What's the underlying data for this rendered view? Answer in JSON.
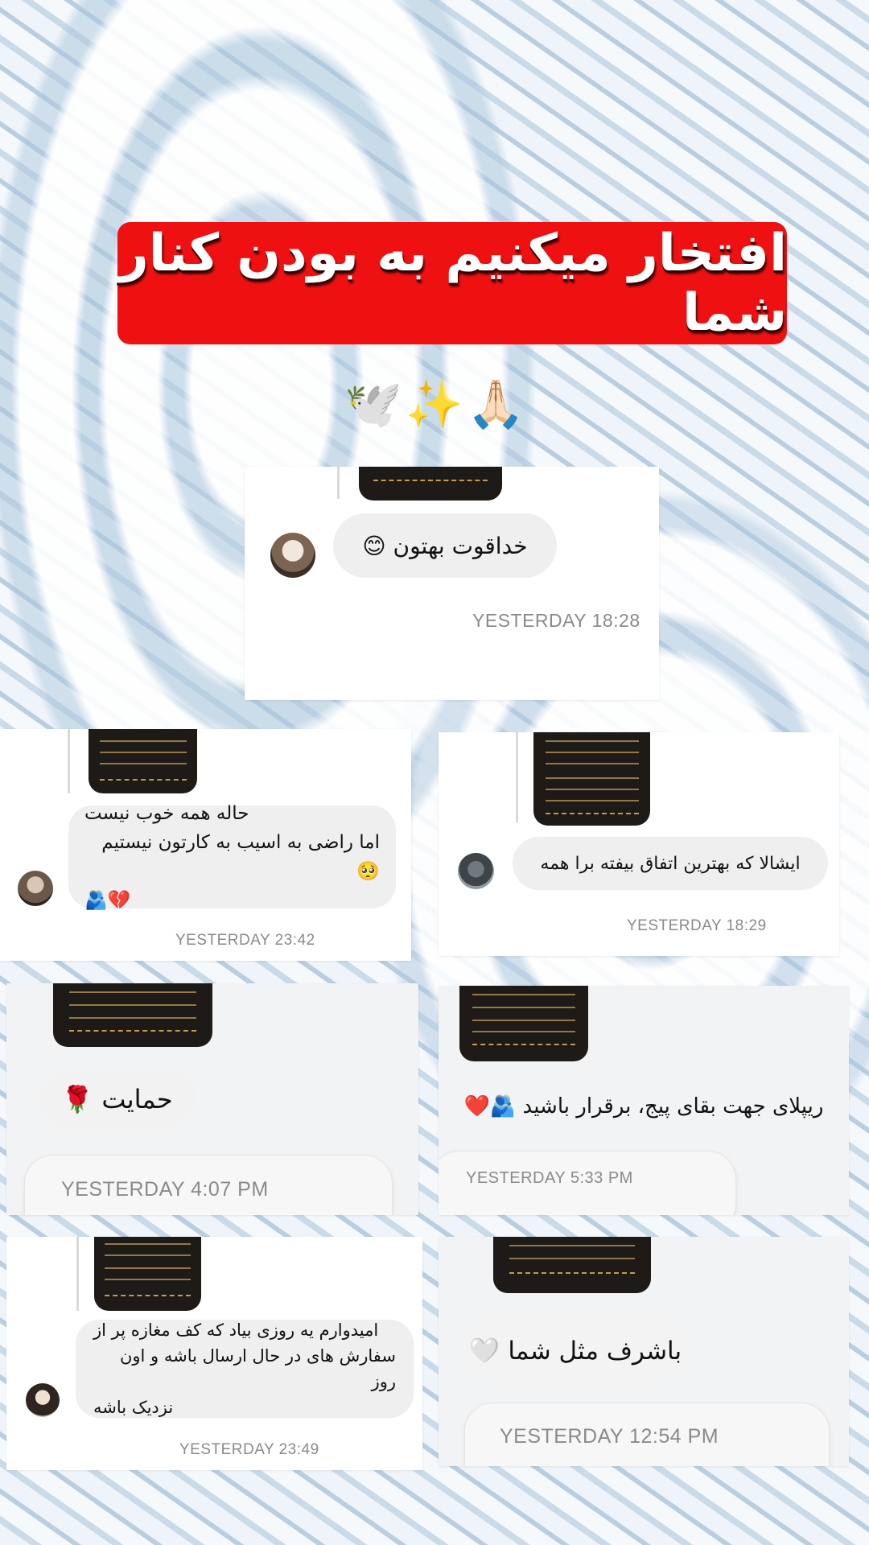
{
  "banner": {
    "title": "افتخار میکنیم به بودن کنار شما"
  },
  "emojis": {
    "dove": "🕊️",
    "sparkles": "✨",
    "pray": "🙏🏻"
  },
  "cards": [
    {
      "message": "خداقوت بهتون 😊",
      "time": "YESTERDAY 18:28"
    },
    {
      "line1": "حاله همه خوب نیست",
      "line2": "اما راضی به اسیب به کارتون نیستیم🥺",
      "line3": "💔🫂",
      "time": "YESTERDAY 23:42"
    },
    {
      "message": "ایشالا که بهترین اتفاق بیفته برا همه",
      "time": "YESTERDAY 18:29"
    },
    {
      "message": "حمایت 🌹",
      "time": "YESTERDAY 4:07 PM"
    },
    {
      "message": "ریپلای جهت بقای  پیج، برقرار باشید 🫂❤️",
      "time": "YESTERDAY 5:33 PM"
    },
    {
      "line1": "امیدوارم یه روزی بیاد که کف مغازه پر از",
      "line2": "سفارش های در حال ارسال باشه و اون روز",
      "line3": "نزدیک باشه",
      "time": "YESTERDAY 23:49"
    },
    {
      "message": "باشرف مثل شما 🤍",
      "time": "YESTERDAY 12:54 PM"
    }
  ]
}
